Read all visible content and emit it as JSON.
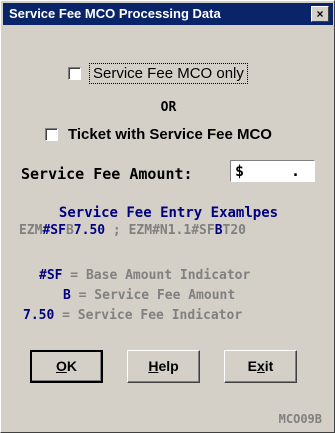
{
  "window": {
    "title": "Service Fee MCO Processing Data",
    "close_label": "×"
  },
  "options": {
    "mco_only_label": "Service Fee MCO only",
    "or_label": "OR",
    "ticket_label": "Ticket with Service Fee MCO"
  },
  "amount": {
    "label": "Service Fee Amount:",
    "currency": "$",
    "dot": "."
  },
  "examples": {
    "title": "Service Fee Entry Examlpes",
    "ex1_a": "EZM",
    "ex1_b": "#SF",
    "ex1_c": "B",
    "ex1_d": "7.50",
    "sep": " ; ",
    "ex2_a": "EZM#N1.1#SF",
    "ex2_b": "B",
    "ex2_c": "T20"
  },
  "legend": [
    {
      "key": "#SF",
      "text": " = Base Amount Indicator"
    },
    {
      "key": "B",
      "text": " = Service Fee Amount"
    },
    {
      "key": "7.50",
      "text": " = Service Fee Indicator"
    }
  ],
  "buttons": {
    "ok_mnemonic": "O",
    "ok_rest": "K",
    "help_mnemonic": "H",
    "help_rest": "elp",
    "exit_pre": "E",
    "exit_mnemonic": "x",
    "exit_rest": "it"
  },
  "form_code": "MCO09B"
}
